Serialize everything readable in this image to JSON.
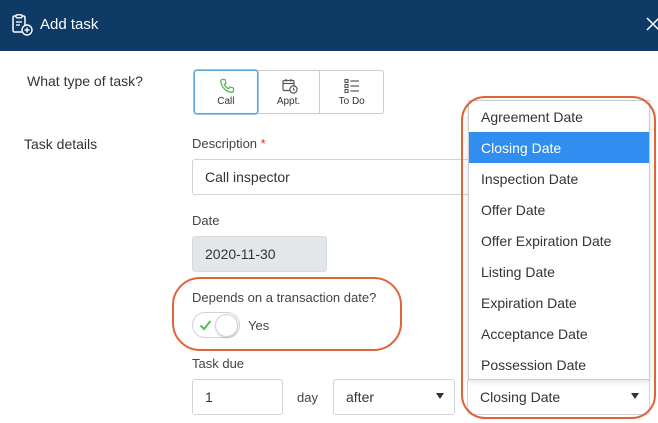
{
  "dialog": {
    "title": "Add task"
  },
  "labels": {
    "task_type_question": "What type of task?",
    "task_details": "Task details",
    "description": "Description",
    "required_marker": "*",
    "date": "Date",
    "depends": "Depends on a transaction date?",
    "toggle_state": "Yes",
    "task_due": "Task due",
    "day_unit": "day"
  },
  "task_types": [
    {
      "label": "Call",
      "icon": "phone-icon",
      "selected": true
    },
    {
      "label": "Appt.",
      "icon": "calendar-clock-icon",
      "selected": false
    },
    {
      "label": "To Do",
      "icon": "checklist-icon",
      "selected": false
    }
  ],
  "fields": {
    "description_value": "Call inspector",
    "date_value": "2020-11-30",
    "due_amount": "1",
    "due_relation": "after",
    "due_reference": "Closing Date"
  },
  "toggle": {
    "on": true
  },
  "dropdown": {
    "selected": "Closing Date",
    "options": [
      "Agreement Date",
      "Closing Date",
      "Inspection Date",
      "Offer Date",
      "Offer Expiration Date",
      "Listing Date",
      "Expiration Date",
      "Acceptance Date",
      "Possession Date"
    ]
  },
  "colors": {
    "header_bg": "#0e3a66",
    "selected_option_bg": "#2f8ef0",
    "highlight_outline": "#e2623a",
    "required_marker": "#d0312d",
    "toggle_check": "#5cb85c"
  }
}
